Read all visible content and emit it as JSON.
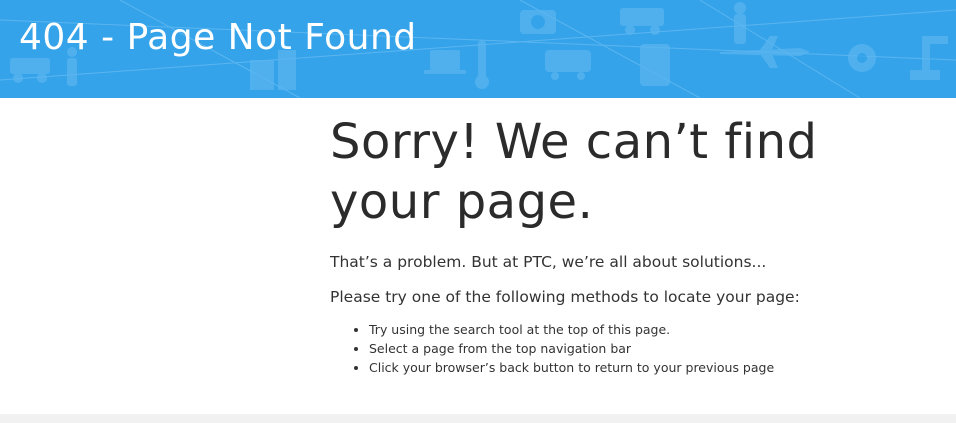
{
  "banner": {
    "title": "404 - Page Not Found",
    "background_color": "#35a3ea"
  },
  "main": {
    "headline_line1": "Sorry! We can’t find",
    "headline_line2": "your page.",
    "intro": "That’s a problem. But at PTC, we’re all about solutions...",
    "instructions": "Please try one of the following methods to locate your page:",
    "tips": [
      "Try using the search tool at the top of this page.",
      "Select a page from the top navigation bar",
      "Click your browser’s back button to return to your previous page"
    ]
  }
}
